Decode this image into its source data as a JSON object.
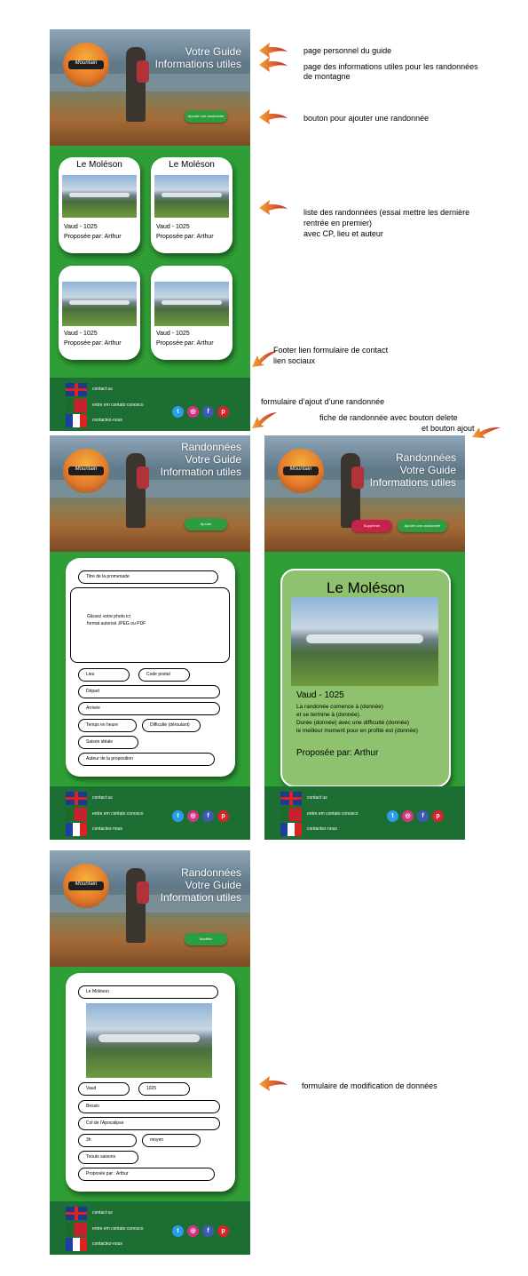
{
  "screen1": {
    "hero_title_1": "Votre Guide",
    "hero_title_2": "Informations utiles",
    "add_button": "Ajouter une randonnée",
    "cards": [
      {
        "title": "Le Moléson",
        "location": "Vaud - 1025",
        "author": "Proposée par: Arthur"
      },
      {
        "title": "Le Moléson",
        "location": "Vaud - 1025",
        "author": "Proposée par: Arthur"
      },
      {
        "title": "",
        "location": "Vaud - 1025",
        "author": "Proposée par: Arthur"
      },
      {
        "title": "",
        "location": "Vaud - 1025",
        "author": "Proposée par: Arthur"
      }
    ]
  },
  "footer": {
    "link_en": "contact us",
    "link_pt": "entre em contato conosco",
    "link_fr": "contactez-nous"
  },
  "screen2": {
    "hero_title_1": "Randonnées",
    "hero_title_2": "Votre Guide",
    "hero_title_3": "Information utiles",
    "button": "Ajouter",
    "fields": {
      "title": "Titre de la promenade",
      "photo_1": "Glissez votre photo ici",
      "photo_2": "format autorisé JPEG ou PDF",
      "lieu": "Lieu",
      "postal": "Code postal",
      "depart": "Départ",
      "arrivee": "Arrivée",
      "temps": "Temps en heure",
      "difficulte": "Difficulté (déroulant)",
      "saison": "Saison idéale",
      "auteur": "Auteur de la proposition"
    }
  },
  "screen3": {
    "hero_title_1": "Randonnées",
    "hero_title_2": "Votre Guide",
    "hero_title_3": "Informations utiles",
    "delete_button": "Supprimer",
    "add_button": "Ajouter une randonnée",
    "card_title": "Le Moléson",
    "location": "Vaud - 1025",
    "desc_1": "La randonée comence à (donnée)",
    "desc_2": "et se termine à (donnée).",
    "desc_3": "Durée (donnée) avec une difficulté (donnée)",
    "desc_4": "le meilleur moment pour en profité est (donnée)",
    "author": "Proposée par: Arthur"
  },
  "screen4": {
    "hero_title_1": "Randonnées",
    "hero_title_2": "Votre Guide",
    "hero_title_3": "Information utiles",
    "button": "Modifier",
    "fields": {
      "title": "Le Moléson",
      "lieu": "Vaud",
      "postal": "1025",
      "depart": "Bessin",
      "arrivee": "Col de l'Apocalipse",
      "temps": "3h",
      "difficulte": "moyen",
      "saison": "Toouts saisons",
      "auteur": "Proposée par : Arthur"
    }
  },
  "annotations": {
    "n1": "page personnel du guide",
    "n2a": "page des informations utiles pour les randonnées",
    "n2b": "de montagne",
    "n3": "bouton pour ajouter une randonnée",
    "n4a": "liste des randonnées (essai mettre les dernière",
    "n4b": "rentrée en premier)",
    "n4c": "avec CP, lieu et auteur",
    "n5a": "Footer lien formulaire de contact",
    "n5b": "lien sociaux",
    "n6": "formulaire d’ajout d’une randonnée",
    "n7a": "fiche de randonnée avec bouton delete",
    "n7b": "et bouton ajout",
    "n8": "formulaire de modification de données"
  },
  "colors": {
    "screen_green": "#2f9e36",
    "footer_green": "#1c6e32",
    "detail_card": "#8fc26e",
    "delete_red": "#c5234a"
  }
}
